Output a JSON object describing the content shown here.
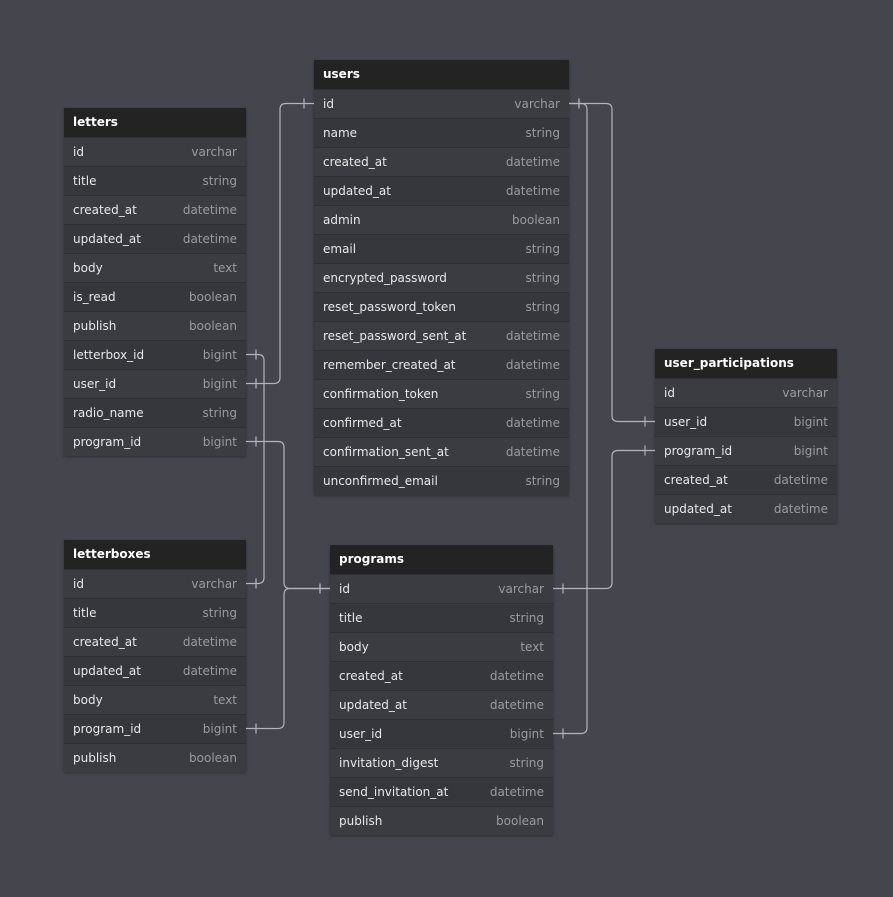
{
  "tables": {
    "letters": {
      "title": "letters",
      "columns": [
        {
          "name": "id",
          "type": "varchar"
        },
        {
          "name": "title",
          "type": "string"
        },
        {
          "name": "created_at",
          "type": "datetime"
        },
        {
          "name": "updated_at",
          "type": "datetime"
        },
        {
          "name": "body",
          "type": "text"
        },
        {
          "name": "is_read",
          "type": "boolean"
        },
        {
          "name": "publish",
          "type": "boolean"
        },
        {
          "name": "letterbox_id",
          "type": "bigint"
        },
        {
          "name": "user_id",
          "type": "bigint"
        },
        {
          "name": "radio_name",
          "type": "string"
        },
        {
          "name": "program_id",
          "type": "bigint"
        }
      ]
    },
    "users": {
      "title": "users",
      "columns": [
        {
          "name": "id",
          "type": "varchar"
        },
        {
          "name": "name",
          "type": "string"
        },
        {
          "name": "created_at",
          "type": "datetime"
        },
        {
          "name": "updated_at",
          "type": "datetime"
        },
        {
          "name": "admin",
          "type": "boolean"
        },
        {
          "name": "email",
          "type": "string"
        },
        {
          "name": "encrypted_password",
          "type": "string"
        },
        {
          "name": "reset_password_token",
          "type": "string"
        },
        {
          "name": "reset_password_sent_at",
          "type": "datetime"
        },
        {
          "name": "remember_created_at",
          "type": "datetime"
        },
        {
          "name": "confirmation_token",
          "type": "string"
        },
        {
          "name": "confirmed_at",
          "type": "datetime"
        },
        {
          "name": "confirmation_sent_at",
          "type": "datetime"
        },
        {
          "name": "unconfirmed_email",
          "type": "string"
        }
      ]
    },
    "user_participations": {
      "title": "user_participations",
      "columns": [
        {
          "name": "id",
          "type": "varchar"
        },
        {
          "name": "user_id",
          "type": "bigint"
        },
        {
          "name": "program_id",
          "type": "bigint"
        },
        {
          "name": "created_at",
          "type": "datetime"
        },
        {
          "name": "updated_at",
          "type": "datetime"
        }
      ]
    },
    "letterboxes": {
      "title": "letterboxes",
      "columns": [
        {
          "name": "id",
          "type": "varchar"
        },
        {
          "name": "title",
          "type": "string"
        },
        {
          "name": "created_at",
          "type": "datetime"
        },
        {
          "name": "updated_at",
          "type": "datetime"
        },
        {
          "name": "body",
          "type": "text"
        },
        {
          "name": "program_id",
          "type": "bigint"
        },
        {
          "name": "publish",
          "type": "boolean"
        }
      ]
    },
    "programs": {
      "title": "programs",
      "columns": [
        {
          "name": "id",
          "type": "varchar"
        },
        {
          "name": "title",
          "type": "string"
        },
        {
          "name": "body",
          "type": "text"
        },
        {
          "name": "created_at",
          "type": "datetime"
        },
        {
          "name": "updated_at",
          "type": "datetime"
        },
        {
          "name": "user_id",
          "type": "bigint"
        },
        {
          "name": "invitation_digest",
          "type": "string"
        },
        {
          "name": "send_invitation_at",
          "type": "datetime"
        },
        {
          "name": "publish",
          "type": "boolean"
        }
      ]
    }
  },
  "relations": [
    {
      "from": "letters.letterbox_id",
      "to": "letterboxes.id"
    },
    {
      "from": "letters.user_id",
      "to": "users.id"
    },
    {
      "from": "letters.program_id",
      "to": "programs.id"
    },
    {
      "from": "letterboxes.program_id",
      "to": "programs.id"
    },
    {
      "from": "user_participations.user_id",
      "to": "users.id"
    },
    {
      "from": "user_participations.program_id",
      "to": "programs.id"
    },
    {
      "from": "programs.user_id",
      "to": "users.id"
    }
  ],
  "colors": {
    "background": "#45454d",
    "header": "#232323",
    "connector": "#b4b4bc"
  }
}
